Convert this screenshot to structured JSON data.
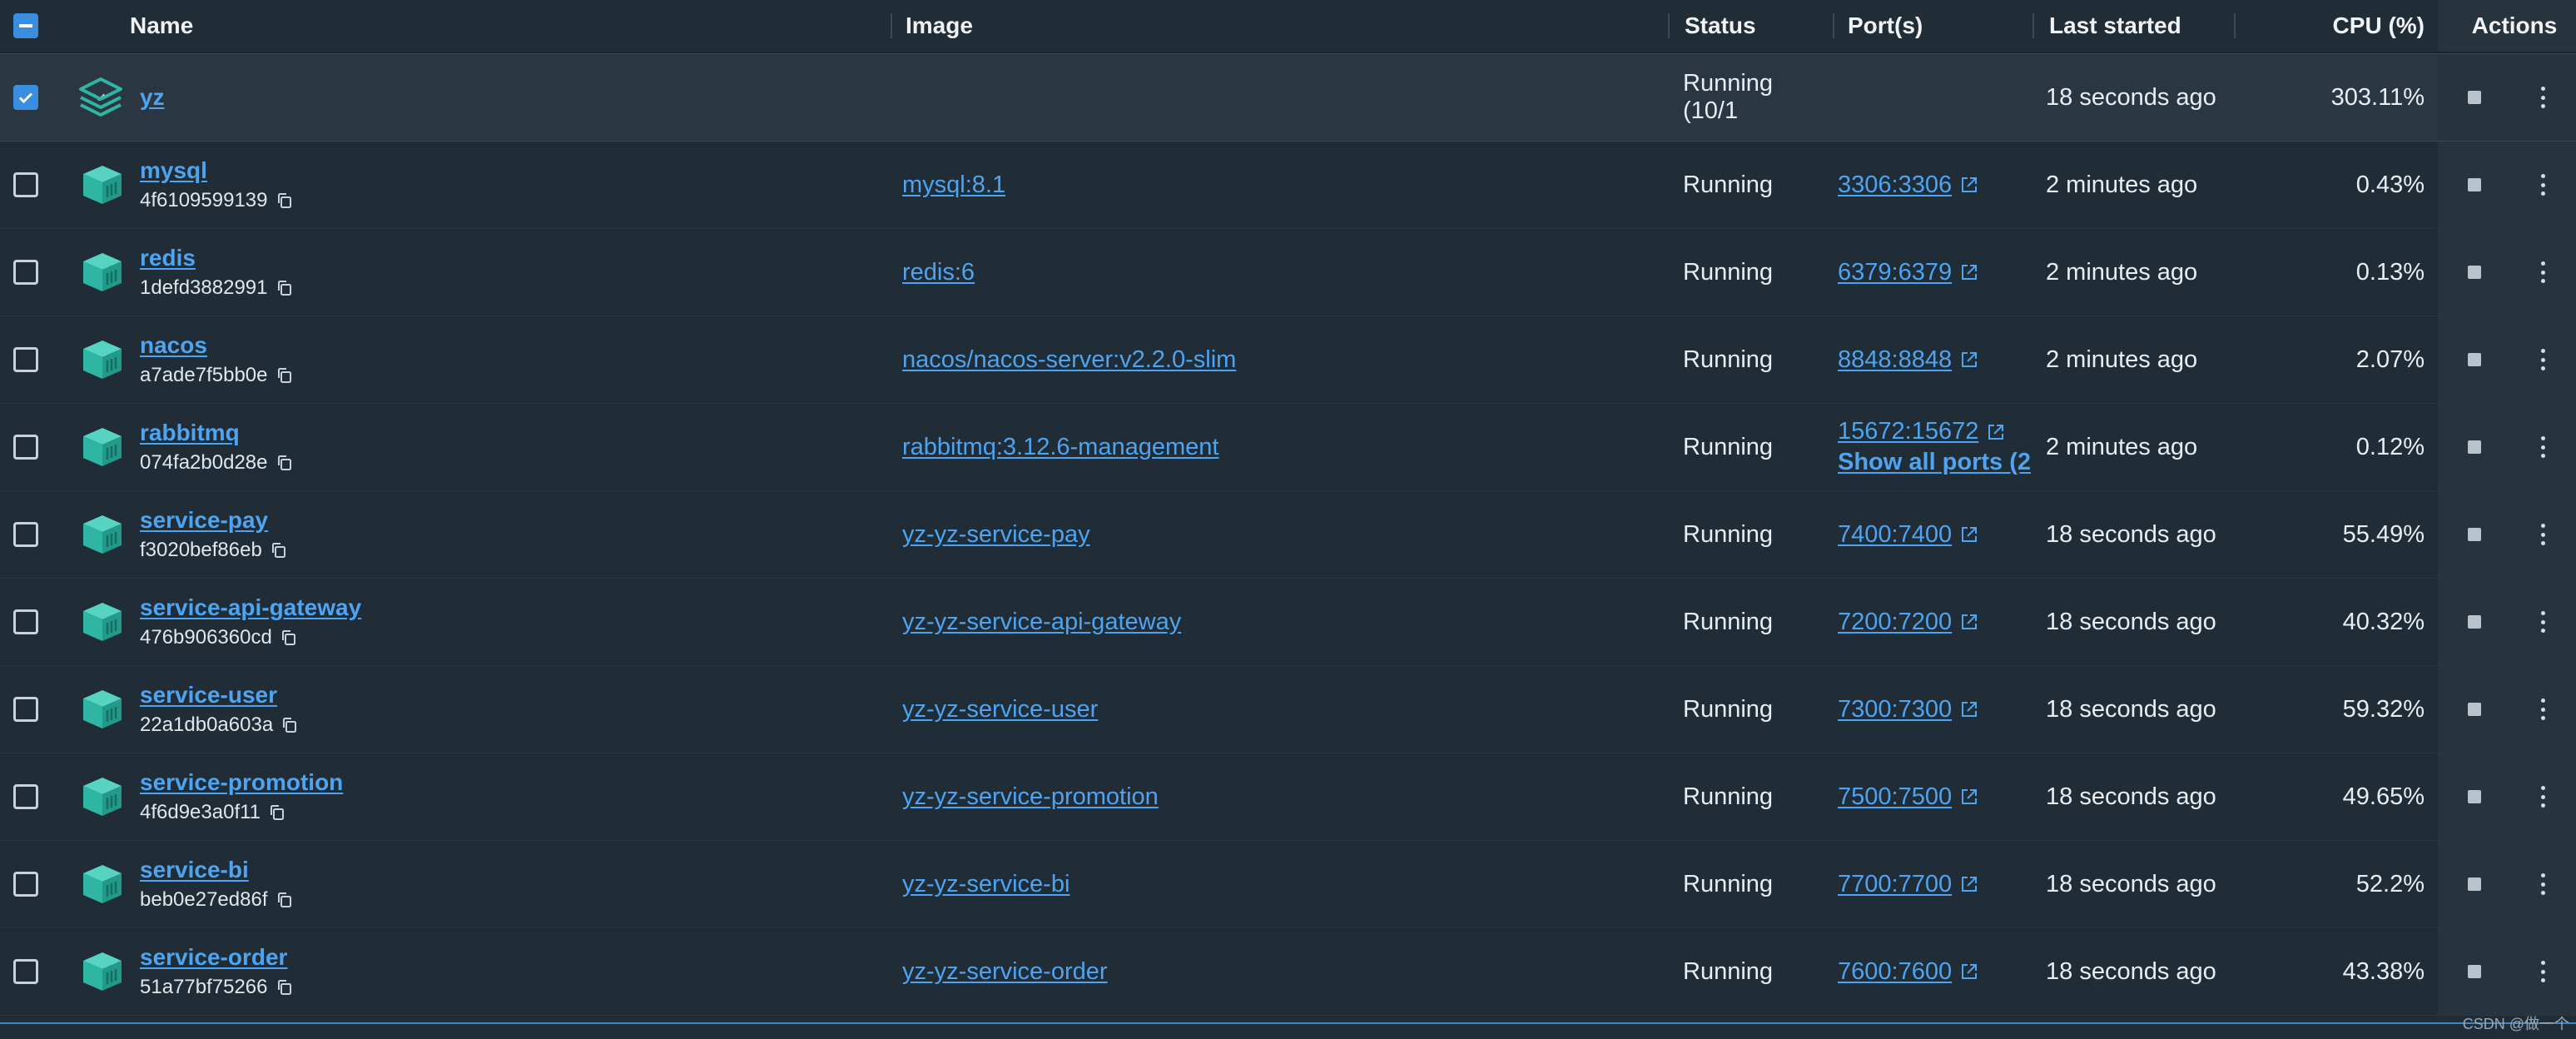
{
  "columns": {
    "name": "Name",
    "image": "Image",
    "status": "Status",
    "ports": "Port(s)",
    "last_started": "Last started",
    "cpu": "CPU (%)",
    "actions": "Actions"
  },
  "group": {
    "name": "yz",
    "status": "Running (10/1",
    "last_started": "18 seconds ago",
    "cpu": "303.11%"
  },
  "containers": [
    {
      "name": "mysql",
      "id": "4f6109599139",
      "image": "mysql:8.1",
      "status": "Running",
      "port": "3306:3306",
      "last_started": "2 minutes ago",
      "cpu": "0.43%"
    },
    {
      "name": "redis",
      "id": "1defd3882991",
      "image": "redis:6",
      "status": "Running",
      "port": "6379:6379",
      "last_started": "2 minutes ago",
      "cpu": "0.13%"
    },
    {
      "name": "nacos",
      "id": "a7ade7f5bb0e",
      "image": "nacos/nacos-server:v2.2.0-slim",
      "status": "Running",
      "port": "8848:8848",
      "last_started": "2 minutes ago",
      "cpu": "2.07%"
    },
    {
      "name": "rabbitmq",
      "id": "074fa2b0d28e",
      "image": "rabbitmq:3.12.6-management",
      "status": "Running",
      "port": "15672:15672",
      "show_all": "Show all ports (2",
      "last_started": "2 minutes ago",
      "cpu": "0.12%"
    },
    {
      "name": "service-pay",
      "id": "f3020bef86eb",
      "image": "yz-yz-service-pay",
      "status": "Running",
      "port": "7400:7400",
      "last_started": "18 seconds ago",
      "cpu": "55.49%"
    },
    {
      "name": "service-api-gateway",
      "id": "476b906360cd",
      "image": "yz-yz-service-api-gateway",
      "status": "Running",
      "port": "7200:7200",
      "last_started": "18 seconds ago",
      "cpu": "40.32%"
    },
    {
      "name": "service-user",
      "id": "22a1db0a603a",
      "image": "yz-yz-service-user",
      "status": "Running",
      "port": "7300:7300",
      "last_started": "18 seconds ago",
      "cpu": "59.32%"
    },
    {
      "name": "service-promotion",
      "id": "4f6d9e3a0f11",
      "image": "yz-yz-service-promotion",
      "status": "Running",
      "port": "7500:7500",
      "last_started": "18 seconds ago",
      "cpu": "49.65%"
    },
    {
      "name": "service-bi",
      "id": "beb0e27ed86f",
      "image": "yz-yz-service-bi",
      "status": "Running",
      "port": "7700:7700",
      "last_started": "18 seconds ago",
      "cpu": "52.2%"
    },
    {
      "name": "service-order",
      "id": "51a77bf75266",
      "image": "yz-yz-service-order",
      "status": "Running",
      "port": "7600:7600",
      "last_started": "18 seconds ago",
      "cpu": "43.38%"
    }
  ],
  "icons": {
    "group": "stack-layers-icon",
    "container": "container-cube-icon",
    "copy": "copy-icon",
    "external": "external-link-icon",
    "stop": "stop-icon",
    "more": "kebab-menu-icon"
  },
  "colors": {
    "link": "#4ea4f0",
    "accent": "#3a8ee0",
    "icon_teal": "#2fb5a3"
  },
  "watermark": "CSDN @做一个"
}
